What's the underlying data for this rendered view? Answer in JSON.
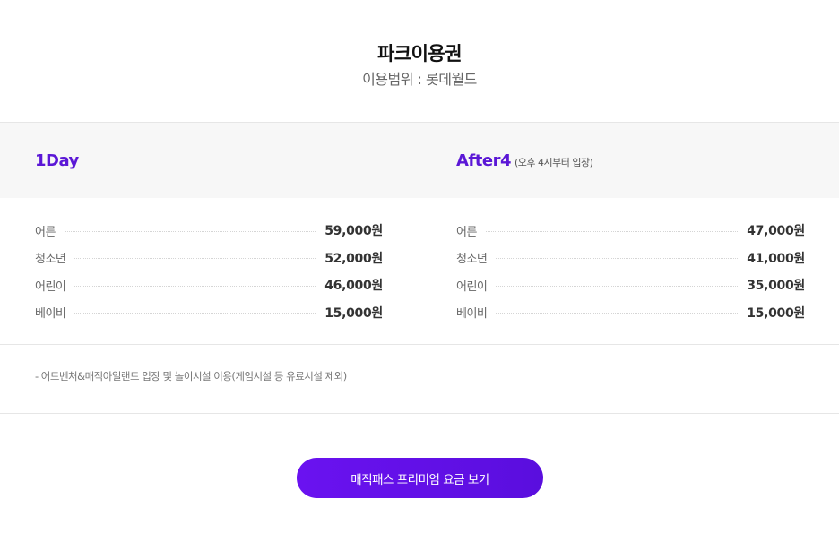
{
  "header": {
    "title": "파크이용권",
    "subtitle": "이용범위 : 롯데월드"
  },
  "plans": [
    {
      "name": "1Day",
      "note": "",
      "rows": [
        {
          "label": "어른",
          "price": "59,000원"
        },
        {
          "label": "청소년",
          "price": "52,000원"
        },
        {
          "label": "어린이",
          "price": "46,000원"
        },
        {
          "label": "베이비",
          "price": "15,000원"
        }
      ]
    },
    {
      "name": "After4",
      "note": "(오후 4시부터 입장)",
      "rows": [
        {
          "label": "어른",
          "price": "47,000원"
        },
        {
          "label": "청소년",
          "price": "41,000원"
        },
        {
          "label": "어린이",
          "price": "35,000원"
        },
        {
          "label": "베이비",
          "price": "15,000원"
        }
      ]
    }
  ],
  "notice": "- 어드벤처&매직아일랜드 입장 및 놀이시설 이용(게임시설 등 유료시설 제외)",
  "cta": {
    "label": "매직패스 프리미엄 요금 보기",
    "color": "#6a12f0"
  },
  "colors": {
    "accent": "#5b17d6"
  }
}
